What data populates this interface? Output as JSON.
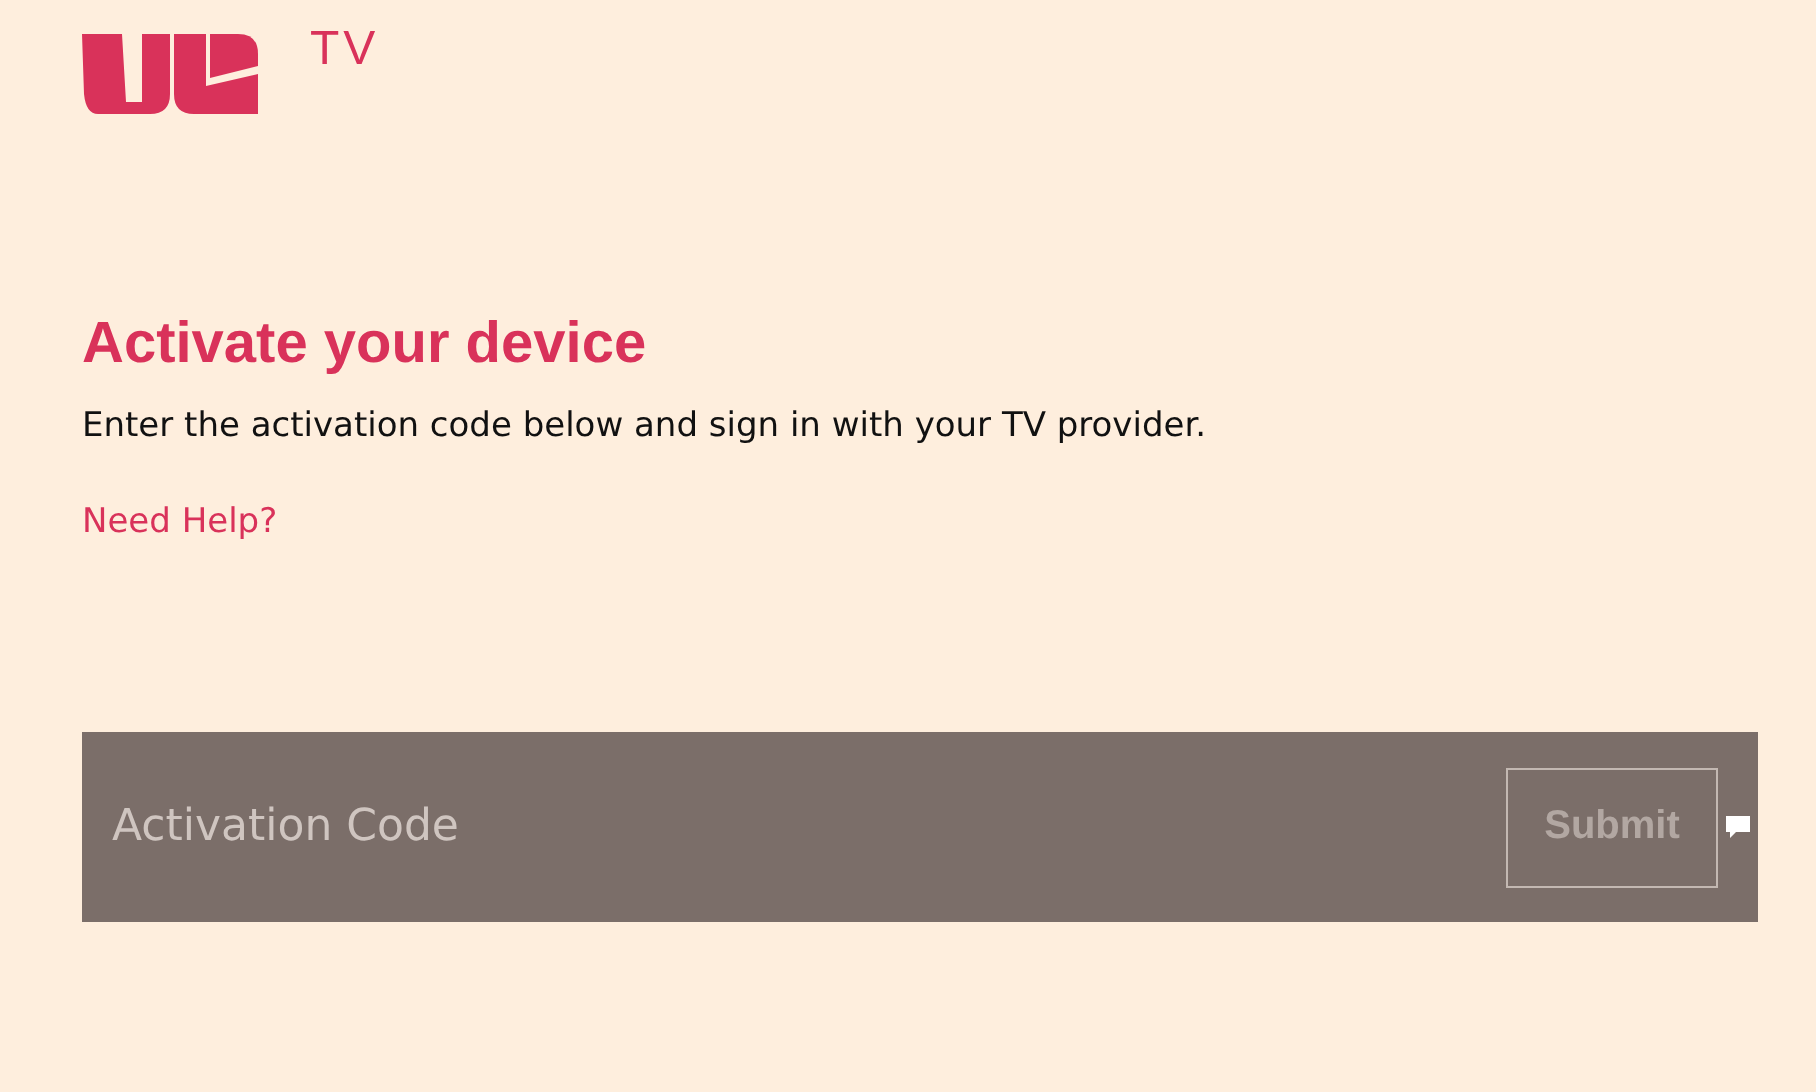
{
  "logo": {
    "text": "TV"
  },
  "heading": "Activate your device",
  "description": "Enter the activation code below and sign in with your TV provider.",
  "help_link": "Need Help?",
  "form": {
    "placeholder": "Activation Code",
    "submit": "Submit",
    "disabled": true
  }
}
